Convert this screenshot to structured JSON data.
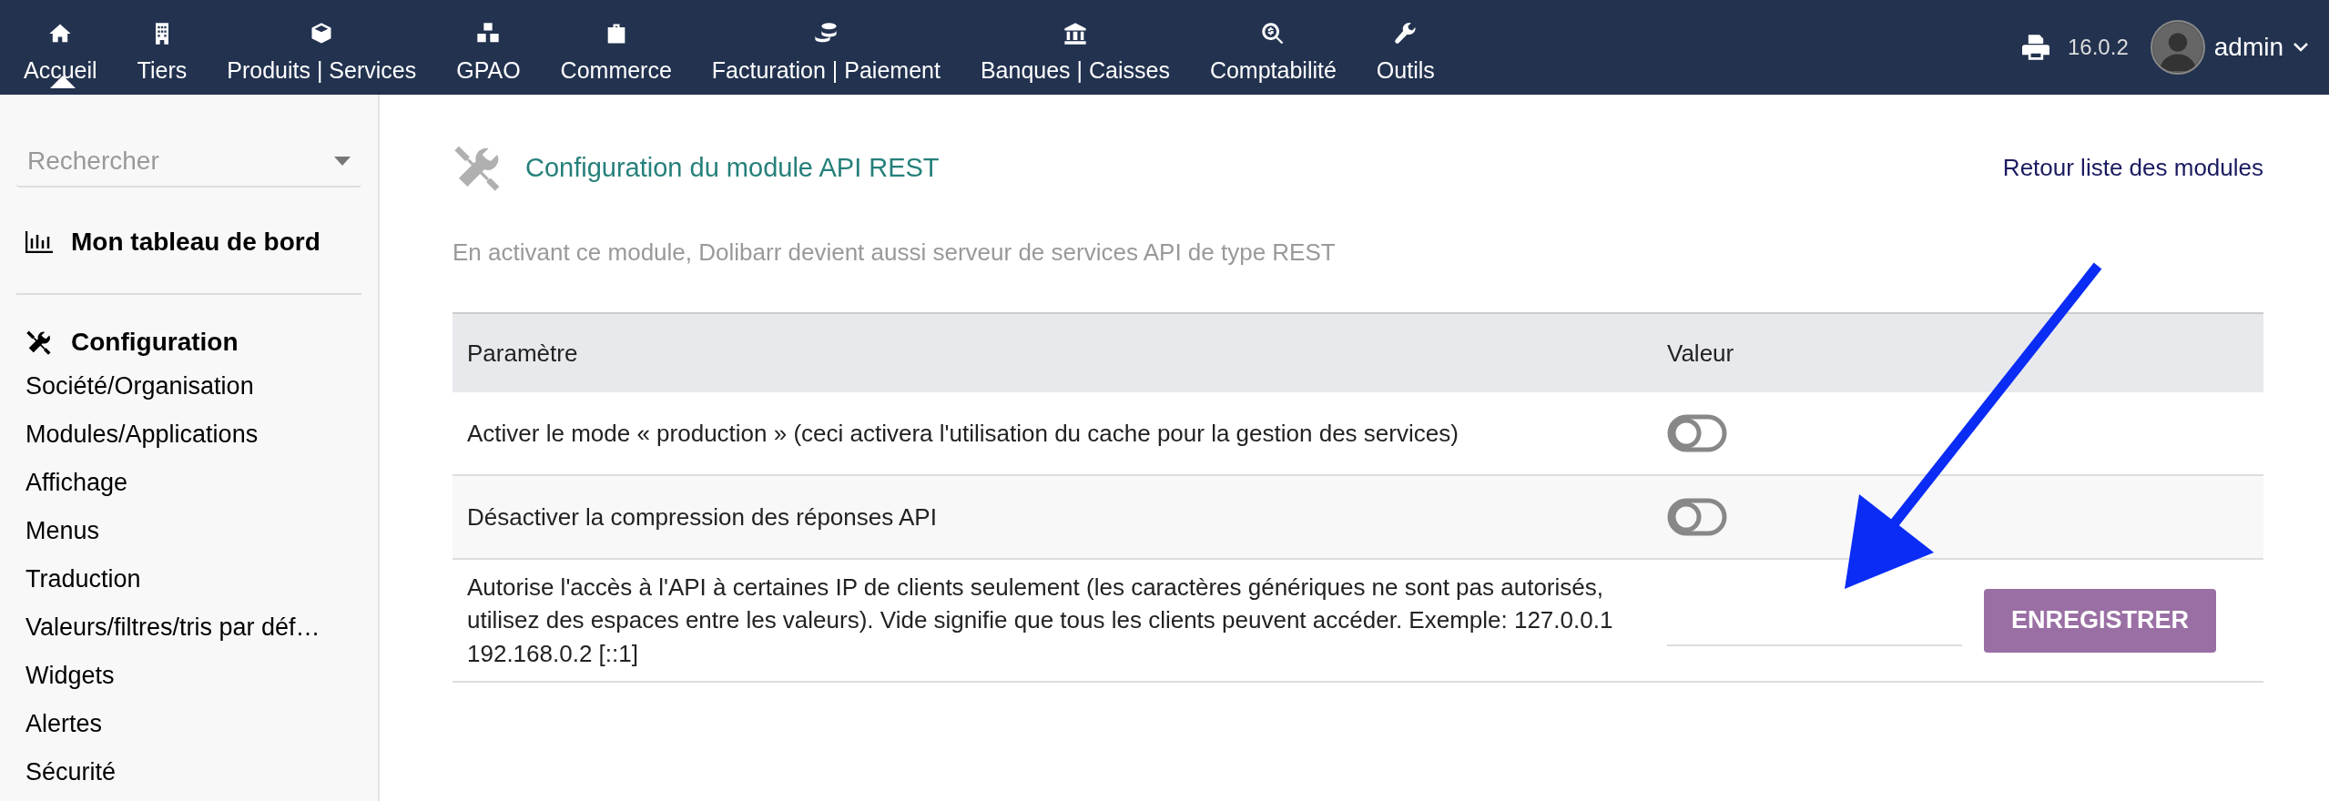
{
  "top_menu": [
    {
      "label": "Accueil",
      "selected": true
    },
    {
      "label": "Tiers",
      "selected": false
    },
    {
      "label": "Produits | Services",
      "selected": false
    },
    {
      "label": "GPAO",
      "selected": false
    },
    {
      "label": "Commerce",
      "selected": false
    },
    {
      "label": "Facturation | Paiement",
      "selected": false
    },
    {
      "label": "Banques | Caisses",
      "selected": false
    },
    {
      "label": "Comptabilité",
      "selected": false
    },
    {
      "label": "Outils",
      "selected": false
    }
  ],
  "version": "16.0.2",
  "user": "admin",
  "sidebar": {
    "search": {
      "placeholder": "Rechercher"
    },
    "dashboard": "Mon tableau de bord",
    "section": "Configuration",
    "items": [
      "Société/Organisation",
      "Modules/Applications",
      "Affichage",
      "Menus",
      "Traduction",
      "Valeurs/filtres/tris par déf…",
      "Widgets",
      "Alertes",
      "Sécurité"
    ]
  },
  "page": {
    "title": "Configuration du module API REST",
    "back_link": "Retour liste des modules",
    "description": "En activant ce module, Dolibarr devient aussi serveur de services API de type REST",
    "table": {
      "columns": [
        "Paramètre",
        "Valeur"
      ],
      "rows": [
        {
          "kind": "toggle",
          "label": "Activer le mode « production » (ceci activera l'utilisation du cache pour la gestion des services)",
          "on": false
        },
        {
          "kind": "toggle",
          "label": "Désactiver la compression des réponses API",
          "on": false
        },
        {
          "kind": "input",
          "label": "Autorise l'accès à l'API à certaines IP de clients seulement (les caractères génériques ne sont pas autorisés, utilisez des espaces entre les valeurs). Vide signifie que tous les clients peuvent accéder. Exemple: 127.0.0.1 192.168.0.2 [::1]",
          "value": "",
          "button": "ENREGISTRER"
        }
      ]
    }
  }
}
